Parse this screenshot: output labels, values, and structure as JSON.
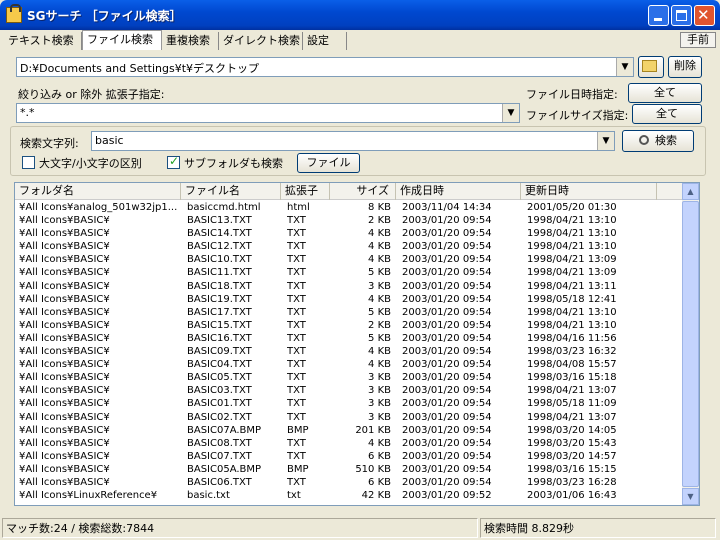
{
  "window": {
    "title": "SGサーチ ［ファイル検索］"
  },
  "tabs": [
    "テキスト検索",
    "ファイル検索",
    "重複検索",
    "ダイレクト検索",
    "設定"
  ],
  "help": "手前",
  "path": {
    "value": "D:¥Documents and Settings¥t¥デスクトップ"
  },
  "delete_label": "削除",
  "filter": {
    "label": "絞り込み or 除外 拡張子指定:",
    "value": "*.*"
  },
  "date_filter": {
    "label": "ファイル日時指定:",
    "button": "全て"
  },
  "size_filter": {
    "label": "ファイルサイズ指定:",
    "button": "全て"
  },
  "search": {
    "label": "検索文字列:",
    "value": "basic",
    "button": "検索"
  },
  "options": {
    "case_label": "大文字/小文字の区別",
    "case_checked": false,
    "subfolder_label": "サブフォルダも検索",
    "subfolder_checked": true,
    "file_button": "ファイル"
  },
  "columns": [
    "フォルダ名",
    "ファイル名",
    "拡張子",
    "サイズ",
    "作成日時",
    "更新日時"
  ],
  "rows": [
    [
      "¥All Icons¥analog_501w32jp1...",
      "basiccmd.html",
      "html",
      "8 KB",
      "2003/11/04 14:34",
      "2001/05/20 01:30"
    ],
    [
      "¥All Icons¥BASIC¥",
      "BASIC13.TXT",
      "TXT",
      "2 KB",
      "2003/01/20 09:54",
      "1998/04/21 13:10"
    ],
    [
      "¥All Icons¥BASIC¥",
      "BASIC14.TXT",
      "TXT",
      "4 KB",
      "2003/01/20 09:54",
      "1998/04/21 13:10"
    ],
    [
      "¥All Icons¥BASIC¥",
      "BASIC12.TXT",
      "TXT",
      "4 KB",
      "2003/01/20 09:54",
      "1998/04/21 13:10"
    ],
    [
      "¥All Icons¥BASIC¥",
      "BASIC10.TXT",
      "TXT",
      "4 KB",
      "2003/01/20 09:54",
      "1998/04/21 13:09"
    ],
    [
      "¥All Icons¥BASIC¥",
      "BASIC11.TXT",
      "TXT",
      "5 KB",
      "2003/01/20 09:54",
      "1998/04/21 13:09"
    ],
    [
      "¥All Icons¥BASIC¥",
      "BASIC18.TXT",
      "TXT",
      "3 KB",
      "2003/01/20 09:54",
      "1998/04/21 13:11"
    ],
    [
      "¥All Icons¥BASIC¥",
      "BASIC19.TXT",
      "TXT",
      "4 KB",
      "2003/01/20 09:54",
      "1998/05/18 12:41"
    ],
    [
      "¥All Icons¥BASIC¥",
      "BASIC17.TXT",
      "TXT",
      "5 KB",
      "2003/01/20 09:54",
      "1998/04/21 13:10"
    ],
    [
      "¥All Icons¥BASIC¥",
      "BASIC15.TXT",
      "TXT",
      "2 KB",
      "2003/01/20 09:54",
      "1998/04/21 13:10"
    ],
    [
      "¥All Icons¥BASIC¥",
      "BASIC16.TXT",
      "TXT",
      "5 KB",
      "2003/01/20 09:54",
      "1998/04/16 11:56"
    ],
    [
      "¥All Icons¥BASIC¥",
      "BASIC09.TXT",
      "TXT",
      "4 KB",
      "2003/01/20 09:54",
      "1998/03/23 16:32"
    ],
    [
      "¥All Icons¥BASIC¥",
      "BASIC04.TXT",
      "TXT",
      "4 KB",
      "2003/01/20 09:54",
      "1998/04/08 15:57"
    ],
    [
      "¥All Icons¥BASIC¥",
      "BASIC05.TXT",
      "TXT",
      "3 KB",
      "2003/01/20 09:54",
      "1998/03/16 15:18"
    ],
    [
      "¥All Icons¥BASIC¥",
      "BASIC03.TXT",
      "TXT",
      "3 KB",
      "2003/01/20 09:54",
      "1998/04/21 13:07"
    ],
    [
      "¥All Icons¥BASIC¥",
      "BASIC01.TXT",
      "TXT",
      "3 KB",
      "2003/01/20 09:54",
      "1998/05/18 11:09"
    ],
    [
      "¥All Icons¥BASIC¥",
      "BASIC02.TXT",
      "TXT",
      "3 KB",
      "2003/01/20 09:54",
      "1998/04/21 13:07"
    ],
    [
      "¥All Icons¥BASIC¥",
      "BASIC07A.BMP",
      "BMP",
      "201 KB",
      "2003/01/20 09:54",
      "1998/03/20 14:05"
    ],
    [
      "¥All Icons¥BASIC¥",
      "BASIC08.TXT",
      "TXT",
      "4 KB",
      "2003/01/20 09:54",
      "1998/03/20 15:43"
    ],
    [
      "¥All Icons¥BASIC¥",
      "BASIC07.TXT",
      "TXT",
      "6 KB",
      "2003/01/20 09:54",
      "1998/03/20 14:57"
    ],
    [
      "¥All Icons¥BASIC¥",
      "BASIC05A.BMP",
      "BMP",
      "510 KB",
      "2003/01/20 09:54",
      "1998/03/16 15:15"
    ],
    [
      "¥All Icons¥BASIC¥",
      "BASIC06.TXT",
      "TXT",
      "6 KB",
      "2003/01/20 09:54",
      "1998/03/23 16:28"
    ],
    [
      "¥All Icons¥LinuxReference¥",
      "basic.txt",
      "txt",
      "42 KB",
      "2003/01/20 09:52",
      "2003/01/06 16:43"
    ]
  ],
  "status": {
    "matches": "マッチ数:24 / 検索総数:7844",
    "time": "検索時間 8.829秒"
  }
}
